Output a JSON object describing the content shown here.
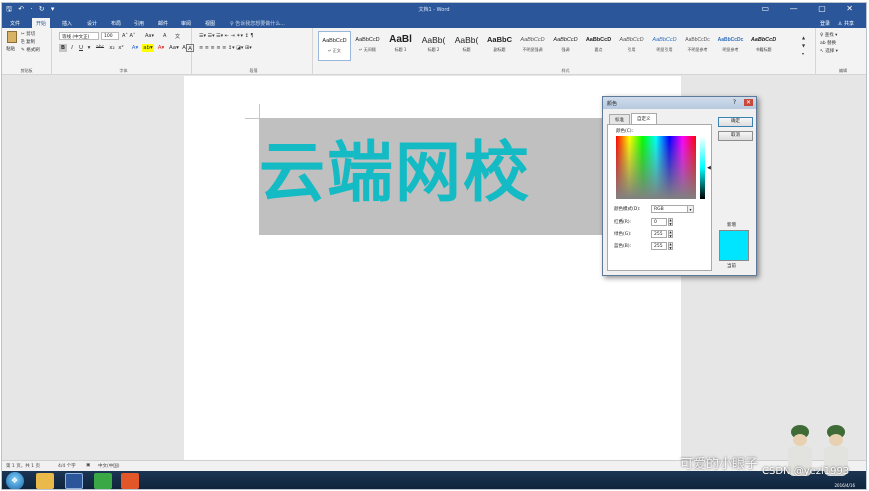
{
  "window": {
    "title": "文档1 - Word",
    "quick_access": "🖫 ↶ · ↻ ▾",
    "window_buttons": "▭ — ▢ ✕"
  },
  "tabs": [
    {
      "label": "文件",
      "active": false
    },
    {
      "label": "开始",
      "active": true
    },
    {
      "label": "插入",
      "active": false
    },
    {
      "label": "设计",
      "active": false
    },
    {
      "label": "布局",
      "active": false
    },
    {
      "label": "引用",
      "active": false
    },
    {
      "label": "邮件",
      "active": false
    },
    {
      "label": "审阅",
      "active": false
    },
    {
      "label": "视图",
      "active": false
    }
  ],
  "tell_me": "♀ 告诉我您想要做什么...",
  "login": "登录",
  "share": "♙ 共享",
  "clipboard": {
    "paste": "粘贴",
    "cut": "✂ 剪切",
    "copy": "⎘ 复制",
    "painter": "✎ 格式刷",
    "label": "剪贴板"
  },
  "font": {
    "name": "等线 (中文正)",
    "size": "100",
    "grow": "A˄ A˅",
    "case": "Aa▾",
    "clear": "A",
    "wen": "文",
    "label": "字体",
    "row2": [
      "B",
      "I",
      "U",
      "▾",
      "abc",
      "x₂",
      "x²",
      "A▾",
      "ab▾",
      "A▾",
      "Aa▾",
      "A",
      "A"
    ]
  },
  "paragraph": {
    "label": "段落",
    "row1": "☰▾ ☰▾ ☰▾  ⇤ ⇥  ✶▾  ↕  ¶",
    "row2": "≡ ≡ ≡ ≡ ≡  ↕▾  ◪▾  ⊞▾"
  },
  "styles": {
    "label": "样式",
    "items": [
      {
        "sample": "AaBbCcD",
        "name": "↵ 正文"
      },
      {
        "sample": "AaBbCcD",
        "name": "↵ 无间隔"
      },
      {
        "sample": "AaBl",
        "name": "标题 1"
      },
      {
        "sample": "AaBb(",
        "name": "标题 2"
      },
      {
        "sample": "AaBb(",
        "name": "标题"
      },
      {
        "sample": "AaBbC",
        "name": "副标题"
      },
      {
        "sample": "AaBbCcD",
        "name": "不明显强调"
      },
      {
        "sample": "AaBbCcD",
        "name": "强调"
      },
      {
        "sample": "AaBbCcD",
        "name": "要点"
      },
      {
        "sample": "AaBbCcD",
        "name": "引用"
      },
      {
        "sample": "AaBbCcD",
        "name": "明显引用"
      },
      {
        "sample": "AaBbCcDc",
        "name": "不明显参考"
      },
      {
        "sample": "AaBbCcDc",
        "name": "明显参考"
      },
      {
        "sample": "AaBbCcD",
        "name": "书籍标题"
      }
    ]
  },
  "editing": {
    "find": "♀ 查找 ▾",
    "replace": "ab 替换",
    "select": "↖ 选择 ▾",
    "label": "编辑"
  },
  "document": {
    "text": "云端网校"
  },
  "color_dialog": {
    "title": "颜色",
    "title_buttons": "? ✕",
    "tabs": [
      "标准",
      "自定义"
    ],
    "colors_label": "颜色(C):",
    "mode_label": "颜色模式(D):",
    "mode_value": "RGB",
    "red_label": "红色(R):",
    "red_value": "0",
    "green_label": "绿色(G):",
    "green_value": "255",
    "blue_label": "蓝色(B):",
    "blue_value": "255",
    "ok": "确定",
    "cancel": "取消",
    "new_label": "新增",
    "current_label": "当前",
    "new_color": "#00e5ff"
  },
  "status": {
    "page": "第 1 页，共 1 页",
    "words": "4/4 个字",
    "lang": "中文(中国)"
  },
  "watermark": {
    "left": "可爱的小眼子",
    "right": "CSDN @yezi1993"
  },
  "clock": "2016/4/16",
  "colors": {
    "word_blue": "#2b579a",
    "text_teal": "#15bbc4"
  }
}
